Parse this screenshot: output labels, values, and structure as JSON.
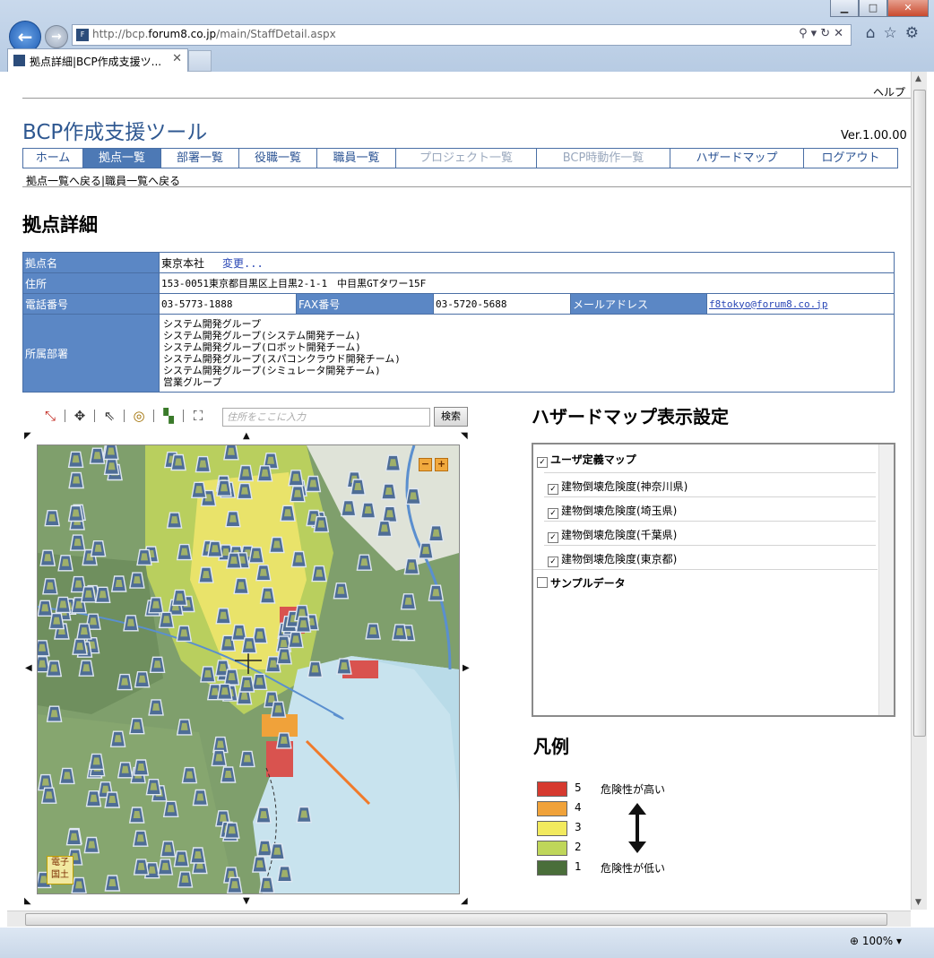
{
  "browser": {
    "url_prefix": "http://bcp.",
    "url_host": "forum8.co.jp",
    "url_path": "/main/StaffDetail.aspx",
    "tab_title": "拠点詳細|BCP作成支援ツ...",
    "zoom": "100%"
  },
  "header": {
    "help": "ヘルプ",
    "app_title": "BCP作成支援ツール",
    "version": "Ver.1.00.00"
  },
  "nav": {
    "items": [
      {
        "label": "ホーム",
        "state": "normal"
      },
      {
        "label": "拠点一覧",
        "state": "active"
      },
      {
        "label": "部署一覧",
        "state": "normal"
      },
      {
        "label": "役職一覧",
        "state": "normal"
      },
      {
        "label": "職員一覧",
        "state": "normal"
      },
      {
        "label": "プロジェクト一覧",
        "state": "disabled"
      },
      {
        "label": "BCP時動作一覧",
        "state": "disabled"
      },
      {
        "label": "ハザードマップ",
        "state": "normal"
      },
      {
        "label": "ログアウト",
        "state": "normal"
      }
    ]
  },
  "subnav": {
    "back_sites": "拠点一覧へ戻る",
    "separator": "|",
    "back_staff": "職員一覧へ戻る"
  },
  "page_title": "拠点詳細",
  "site": {
    "name_label": "拠点名",
    "name": "東京本社",
    "change_link": "変更...",
    "address_label": "住所",
    "address": "153-0051東京都目黒区上目黒2-1-1　中目黒GTタワー15F",
    "phone_label": "電話番号",
    "phone": "03-5773-1888",
    "fax_label": "FAX番号",
    "fax": "03-5720-5688",
    "mail_label": "メールアドレス",
    "mail": "f8tokyo@forum8.co.jp",
    "dept_label": "所属部署",
    "departments": [
      "システム開発グループ",
      "システム開発グループ(システム開発チーム)",
      "システム開発グループ(ロボット開発チーム)",
      "システム開発グループ(スパコンクラウド開発チーム)",
      "システム開発グループ(シミュレータ開発チーム)",
      "営業グループ"
    ]
  },
  "map": {
    "search_placeholder": "住所をここに入力",
    "search_button": "検索",
    "badge": "電子国土",
    "zoom_out": "−",
    "zoom_in": "+"
  },
  "hazard": {
    "title": "ハザードマップ表示設定",
    "layers": [
      {
        "label": "ユーザ定義マップ",
        "checked": true,
        "level": 0
      },
      {
        "label": "建物倒壊危険度(神奈川県)",
        "checked": true,
        "level": 1
      },
      {
        "label": "建物倒壊危険度(埼玉県)",
        "checked": true,
        "level": 1
      },
      {
        "label": "建物倒壊危険度(千葉県)",
        "checked": true,
        "level": 1
      },
      {
        "label": "建物倒壊危険度(東京都)",
        "checked": true,
        "level": 1
      },
      {
        "label": "サンプルデータ",
        "checked": false,
        "level": 0
      }
    ]
  },
  "legend": {
    "title": "凡例",
    "items": [
      {
        "level": "5",
        "color": "#d63a2f"
      },
      {
        "level": "4",
        "color": "#f0a23a"
      },
      {
        "level": "3",
        "color": "#f2ea5e"
      },
      {
        "level": "2",
        "color": "#bfd65a"
      },
      {
        "level": "1",
        "color": "#4a6e3a"
      }
    ],
    "high_text": "危険性が高い",
    "low_text": "危険性が低い"
  }
}
